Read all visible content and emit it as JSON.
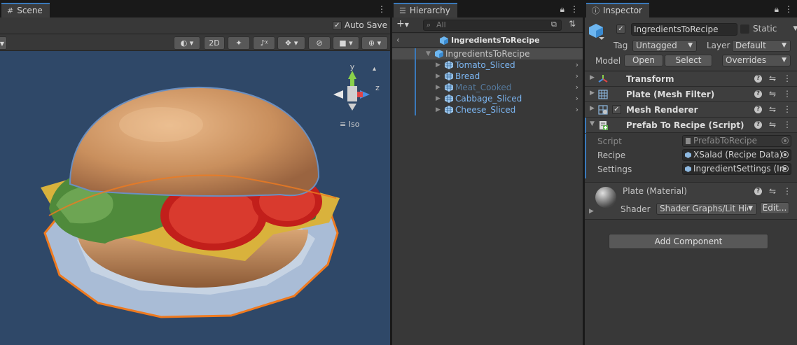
{
  "scene": {
    "tab_label": "Scene",
    "auto_save_label": "Auto Save",
    "toolbar_2d": "2D",
    "iso_label": "Iso",
    "gizmo_y": "y",
    "gizmo_z": "z"
  },
  "hierarchy": {
    "tab_label": "Hierarchy",
    "search_placeholder": "All",
    "prefab_title": "IngredientsToRecipe",
    "root": "IngredientsToRecipe",
    "items": [
      {
        "label": "Tomato_Sliced",
        "color": "#7cb6f2"
      },
      {
        "label": "Bread",
        "color": "#7cb6f2"
      },
      {
        "label": "Meat_Cooked",
        "color": "#55799c"
      },
      {
        "label": "Cabbage_Sliced",
        "color": "#7cb6f2"
      },
      {
        "label": "Cheese_Sliced",
        "color": "#7cb6f2"
      }
    ]
  },
  "inspector": {
    "tab_label": "Inspector",
    "object_name": "IngredientsToRecipe",
    "static_label": "Static",
    "tag_label": "Tag",
    "tag_value": "Untagged",
    "layer_label": "Layer",
    "layer_value": "Default",
    "model_label": "Model",
    "open_label": "Open",
    "select_label": "Select",
    "overrides_label": "Overrides",
    "components": [
      {
        "name": "Transform",
        "icon": "transform-icon"
      },
      {
        "name": "Plate (Mesh Filter)",
        "icon": "mesh-filter-icon"
      },
      {
        "name": "Mesh Renderer",
        "icon": "mesh-renderer-icon"
      },
      {
        "name": "Prefab To Recipe (Script)",
        "icon": "script-icon"
      }
    ],
    "script_props": {
      "script_label": "Script",
      "script_value": "PrefabToRecipe",
      "recipe_label": "Recipe",
      "recipe_value": "XSalad (Recipe Data)",
      "settings_label": "Settings",
      "settings_value": "IngredientSettings (In"
    },
    "material": {
      "name": "Plate (Material)",
      "shader_label": "Shader",
      "shader_value": "Shader Graphs/Lit Hig",
      "edit_label": "Edit..."
    },
    "add_component_label": "Add Component"
  },
  "colors": {
    "accent": "#3a79bb",
    "viewport_bg": "#2f4868",
    "panel_bg": "#383838"
  }
}
